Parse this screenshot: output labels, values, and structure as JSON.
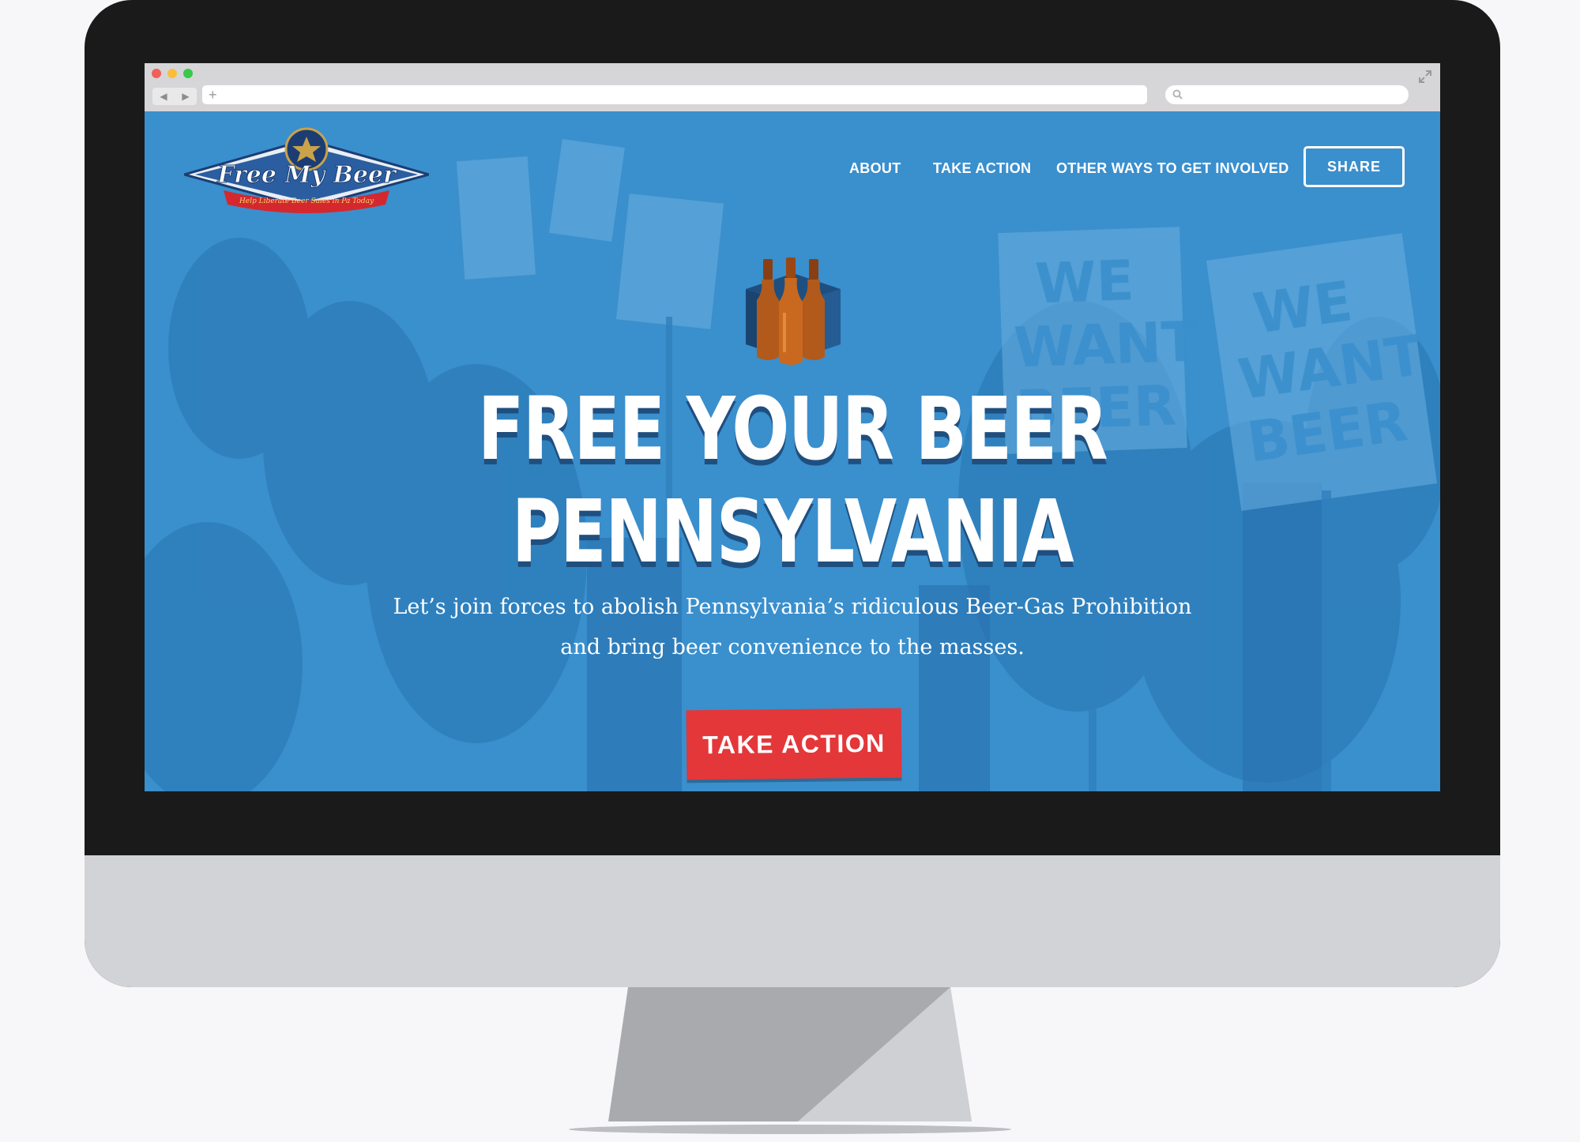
{
  "browser": {
    "traffic_lights": [
      "close",
      "minimize",
      "maximize"
    ],
    "back_icon": "back-arrow-icon",
    "forward_icon": "forward-arrow-icon",
    "new_tab_label": "+",
    "url": "",
    "search_value": ""
  },
  "site": {
    "logo": {
      "title": "Free My Beer",
      "tagline": "Help Liberate Beer Sales in Pa Today"
    },
    "nav": {
      "items": [
        "ABOUT",
        "TAKE ACTION",
        "OTHER WAYS TO GET INVOLVED"
      ],
      "share_label": "SHARE"
    },
    "hero": {
      "headline_line1": "FREE YOUR BEER",
      "headline_line2": "PENNSYLVANIA",
      "sub_line1": "Let’s join forces to abolish Pennsylvania’s ridiculous Beer-Gas Prohibition",
      "sub_line2": "and bring beer convenience to the masses.",
      "cta_label": "TAKE ACTION",
      "sign_text": "WE WANT BEER"
    }
  },
  "colors": {
    "hero_blue": "#3a8fcd",
    "cta_red": "#e3373a",
    "monitor_bezel": "#1a1a1a",
    "monitor_chin": "#d2d3d6"
  }
}
